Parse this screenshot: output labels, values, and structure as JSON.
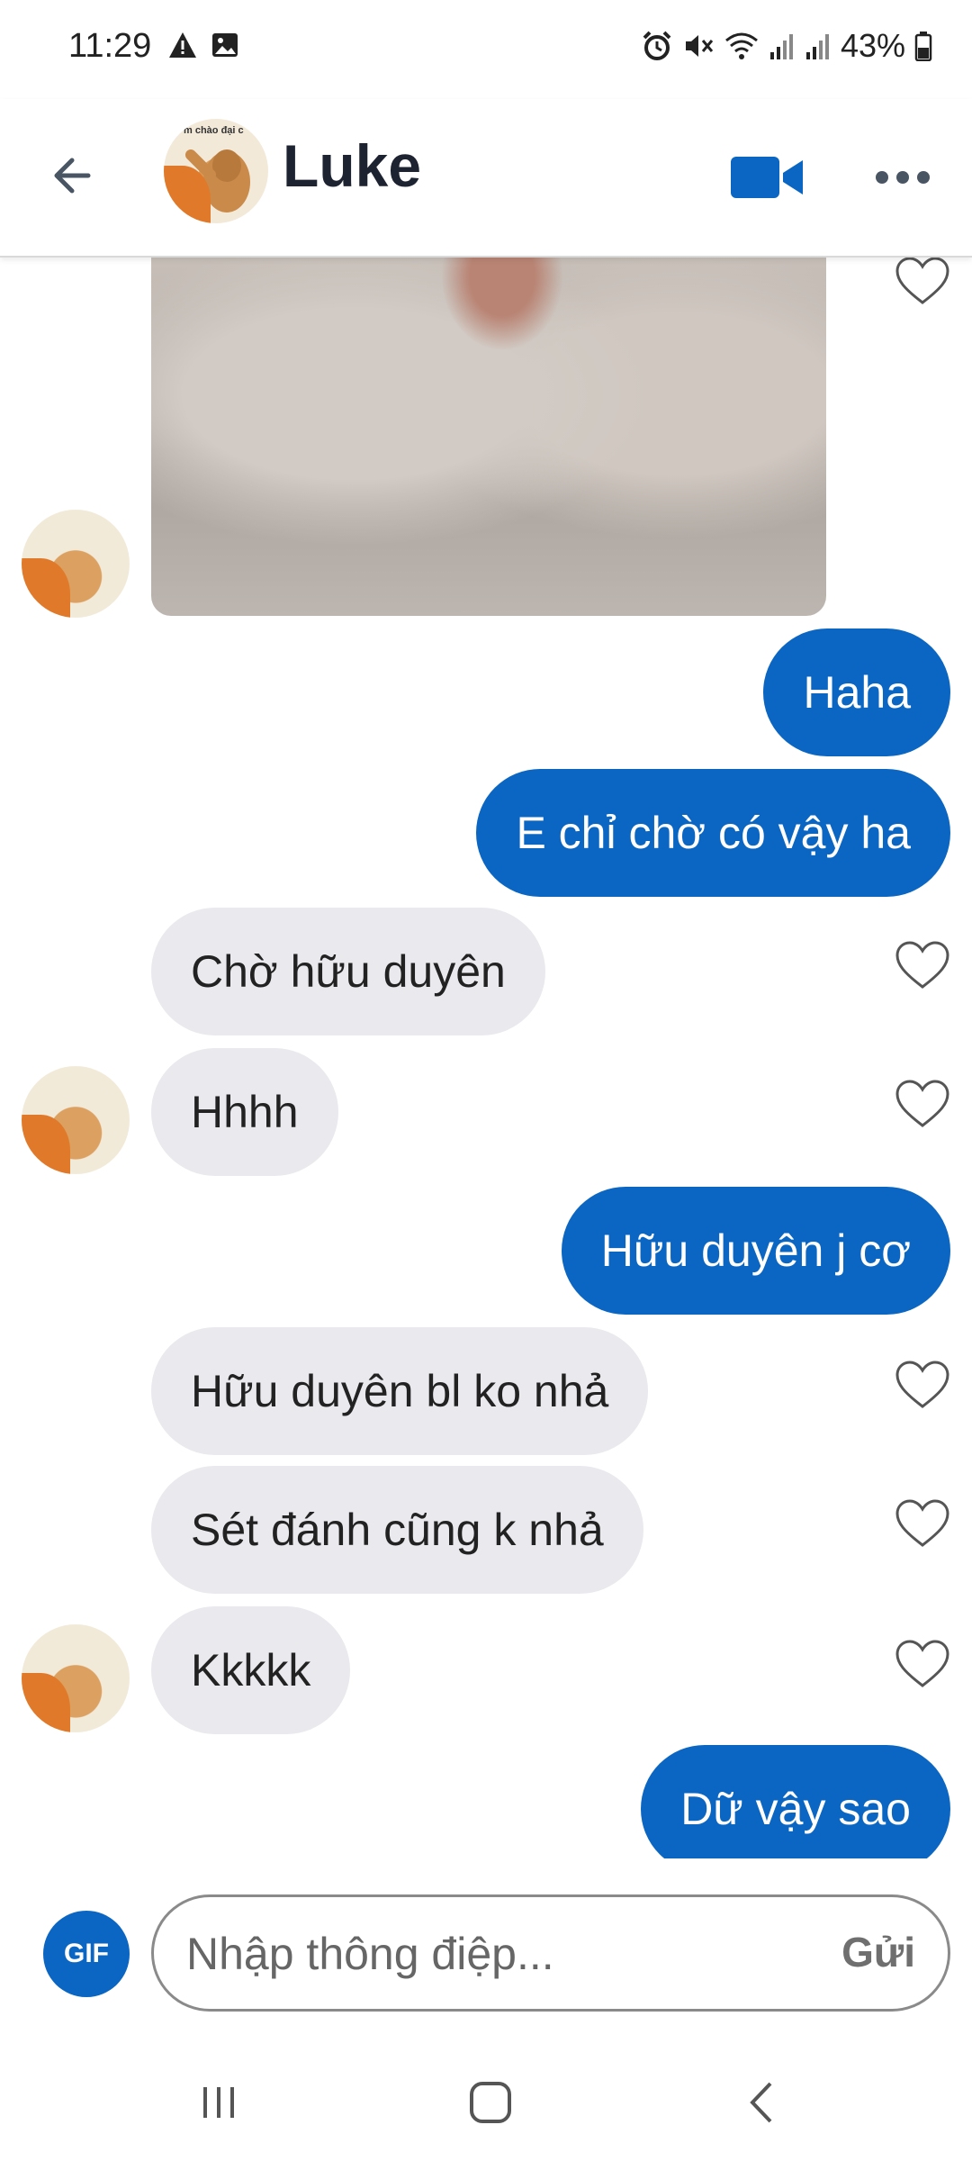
{
  "status_bar": {
    "time": "11:29",
    "battery": "43%",
    "icons": [
      "warning-icon",
      "image-icon",
      "alarm-icon",
      "mute-icon",
      "wifi-icon",
      "signal-icon",
      "signal-icon",
      "battery-icon"
    ]
  },
  "header": {
    "contact_name": "Luke",
    "avatar_caption": "m chào đại c",
    "icons": [
      "back-arrow-icon",
      "video-call-icon",
      "more-icon"
    ]
  },
  "messages": [
    {
      "type": "image",
      "from": "contact"
    },
    {
      "type": "text",
      "from": "me",
      "text": "Haha"
    },
    {
      "type": "text",
      "from": "me",
      "text": "E chỉ chờ có vậy ha"
    },
    {
      "type": "text",
      "from": "contact",
      "text": "Chờ hữu duyên"
    },
    {
      "type": "text",
      "from": "contact",
      "text": "Hhhh"
    },
    {
      "type": "text",
      "from": "me",
      "text": "Hữu duyên j cơ"
    },
    {
      "type": "text",
      "from": "contact",
      "text": "Hữu duyên bl ko nhả"
    },
    {
      "type": "text",
      "from": "contact",
      "text": "Sét đánh cũng k nhả"
    },
    {
      "type": "text",
      "from": "contact",
      "text": "Kkkkk"
    },
    {
      "type": "text",
      "from": "me",
      "text": "Dữ vậy sao"
    }
  ],
  "composer": {
    "gif_label": "GIF",
    "placeholder": "Nhập thông điệp...",
    "send_label": "Gửi"
  },
  "colors": {
    "accent": "#0a66c2",
    "incoming_bubble": "#e9e9ee",
    "outgoing_bubble": "#0a66c2"
  }
}
